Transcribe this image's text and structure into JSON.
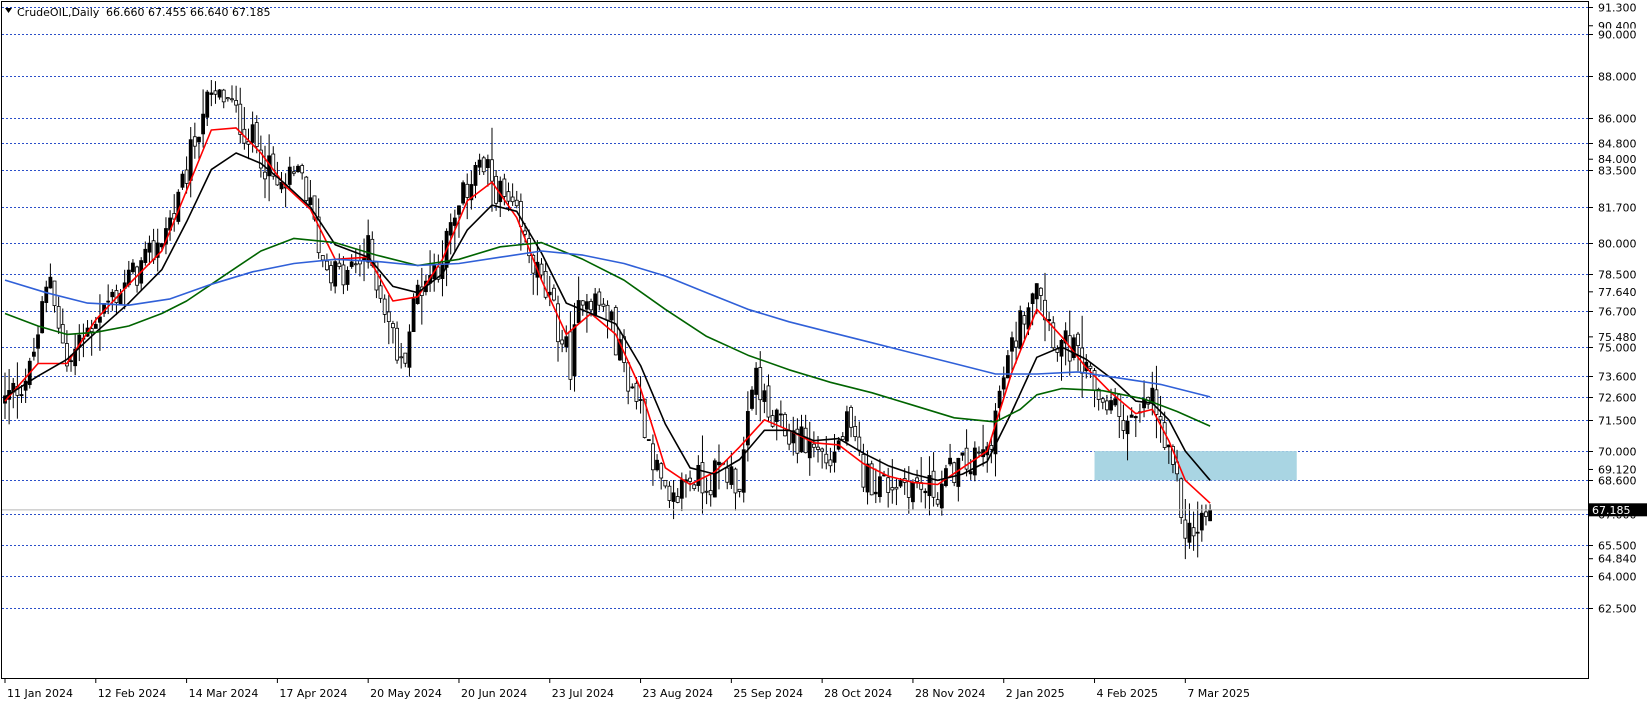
{
  "chart_header": {
    "symbol": "CrudeOIL,Daily",
    "ohlc": "66.660 67.455 66.640 67.185"
  },
  "colors": {
    "grid": "#2b4fc9",
    "candle": "#000000",
    "ma_fast": "#ff0000",
    "ma_medium": "#000000",
    "ma_slow": "#006400",
    "ma_long": "#3060d8",
    "zone_fill": "#a9d5e3",
    "current_line": "#b8b8b8"
  },
  "chart_data": {
    "type": "candlestick",
    "title": "CrudeOIL,Daily",
    "header_ohlc": {
      "open": 66.66,
      "high": 67.455,
      "low": 66.64,
      "close": 67.185
    },
    "current_price_label": "67.185",
    "ylim": [
      62.0,
      91.4
    ],
    "y_gridlines": [
      91.3,
      90.0,
      88.0,
      86.0,
      84.8,
      83.5,
      81.7,
      80.0,
      78.5,
      76.7,
      75.0,
      73.6,
      72.6,
      71.5,
      70.0,
      68.6,
      67.0,
      65.5,
      64.0,
      62.5
    ],
    "y_gridline_labels": [
      "91.300",
      "90.000",
      "88.000",
      "86.000",
      "84.800",
      "83.500",
      "81.700",
      "80.000",
      "78.500",
      "76.700",
      "75.000",
      "73.600",
      "72.600",
      "71.500",
      "70.000",
      "68.600",
      "67.000",
      "65.500",
      "64.000",
      "62.500"
    ],
    "y_scale_ticks": [
      90.4,
      84.0,
      77.64,
      75.48,
      69.12,
      64.84
    ],
    "y_scale_tick_labels": [
      "90.400",
      "84.000",
      "77.640",
      "75.480",
      "69.120",
      "64.840"
    ],
    "x_tick_labels": [
      "11 Jan 2024",
      "12 Feb 2024",
      "14 Mar 2024",
      "17 Apr 2024",
      "20 May 2024",
      "20 Jun 2024",
      "23 Jul 2024",
      "23 Aug 2024",
      "25 Sep 2024",
      "28 Oct 2024",
      "28 Nov 2024",
      "2 Jan 2025",
      "4 Feb 2025",
      "7 Mar 2025"
    ],
    "x_tick_bar_index": [
      0,
      22,
      44,
      66,
      88,
      110,
      132,
      154,
      176,
      198,
      220,
      242,
      264,
      286
    ],
    "close_path": [
      [
        0,
        72.4
      ],
      [
        6,
        73.8
      ],
      [
        11,
        78.5
      ],
      [
        15,
        74.0
      ],
      [
        22,
        76.5
      ],
      [
        28,
        77.8
      ],
      [
        35,
        79.2
      ],
      [
        42,
        81.8
      ],
      [
        48,
        86.5
      ],
      [
        53,
        87.0
      ],
      [
        58,
        85.5
      ],
      [
        62,
        84.3
      ],
      [
        66,
        82.5
      ],
      [
        72,
        83.2
      ],
      [
        77,
        79.2
      ],
      [
        82,
        78.2
      ],
      [
        88,
        79.6
      ],
      [
        92,
        77.0
      ],
      [
        96,
        74.0
      ],
      [
        100,
        77.8
      ],
      [
        105,
        79.0
      ],
      [
        110,
        81.5
      ],
      [
        114,
        83.8
      ],
      [
        118,
        83.0
      ],
      [
        124,
        81.0
      ],
      [
        128,
        79.0
      ],
      [
        133,
        76.5
      ],
      [
        137,
        74.2
      ],
      [
        140,
        77.8
      ],
      [
        146,
        76.6
      ],
      [
        151,
        73.5
      ],
      [
        154,
        72.2
      ],
      [
        158,
        69.0
      ],
      [
        161,
        67.0
      ],
      [
        165,
        68.8
      ],
      [
        170,
        68.5
      ],
      [
        174,
        69.2
      ],
      [
        178,
        68.5
      ],
      [
        182,
        73.8
      ],
      [
        185,
        71.5
      ],
      [
        190,
        70.8
      ],
      [
        196,
        70.2
      ],
      [
        200,
        69.5
      ],
      [
        204,
        71.2
      ],
      [
        208,
        68.9
      ],
      [
        213,
        68.4
      ],
      [
        218,
        68.6
      ],
      [
        222,
        68.2
      ],
      [
        226,
        68.1
      ],
      [
        230,
        69.2
      ],
      [
        234,
        69.3
      ],
      [
        238,
        70.0
      ],
      [
        242,
        73.5
      ],
      [
        246,
        76.2
      ],
      [
        250,
        78.6
      ],
      [
        252,
        76.8
      ],
      [
        255,
        75.2
      ],
      [
        259,
        74.8
      ],
      [
        262,
        73.5
      ],
      [
        266,
        72.5
      ],
      [
        270,
        71.8
      ],
      [
        274,
        71.3
      ],
      [
        278,
        72.6
      ],
      [
        282,
        69.5
      ],
      [
        284,
        68.2
      ],
      [
        286,
        66.2
      ],
      [
        288,
        66.0
      ],
      [
        290,
        66.7
      ],
      [
        292,
        67.2
      ]
    ],
    "series": [
      {
        "type": "line",
        "points": [
          [
            0,
            72.4
          ],
          [
            8,
            74.2
          ],
          [
            15,
            74.2
          ],
          [
            22,
            76.3
          ],
          [
            30,
            78.0
          ],
          [
            38,
            79.6
          ],
          [
            44,
            82.5
          ],
          [
            50,
            85.4
          ],
          [
            56,
            85.5
          ],
          [
            62,
            84.3
          ],
          [
            68,
            82.7
          ],
          [
            74,
            81.6
          ],
          [
            80,
            79.2
          ],
          [
            88,
            79.3
          ],
          [
            94,
            77.2
          ],
          [
            100,
            77.4
          ],
          [
            106,
            79.2
          ],
          [
            112,
            82.0
          ],
          [
            118,
            82.9
          ],
          [
            124,
            81.2
          ],
          [
            130,
            78.2
          ],
          [
            136,
            75.6
          ],
          [
            142,
            76.6
          ],
          [
            148,
            75.6
          ],
          [
            154,
            73.0
          ],
          [
            160,
            69.2
          ],
          [
            166,
            68.4
          ],
          [
            172,
            69.0
          ],
          [
            178,
            70.2
          ],
          [
            184,
            71.5
          ],
          [
            190,
            71.0
          ],
          [
            196,
            70.4
          ],
          [
            202,
            70.3
          ],
          [
            208,
            69.4
          ],
          [
            214,
            68.8
          ],
          [
            220,
            68.5
          ],
          [
            226,
            68.4
          ],
          [
            232,
            69.2
          ],
          [
            238,
            70.0
          ],
          [
            244,
            73.8
          ],
          [
            250,
            76.8
          ],
          [
            256,
            75.5
          ],
          [
            262,
            74.0
          ],
          [
            268,
            72.8
          ],
          [
            274,
            71.8
          ],
          [
            278,
            72.0
          ],
          [
            282,
            70.5
          ],
          [
            286,
            68.6
          ],
          [
            292,
            67.5
          ]
        ]
      },
      {
        "type": "line",
        "points": [
          [
            0,
            72.6
          ],
          [
            8,
            73.6
          ],
          [
            15,
            74.4
          ],
          [
            22,
            75.7
          ],
          [
            30,
            77.1
          ],
          [
            38,
            78.7
          ],
          [
            44,
            81.0
          ],
          [
            50,
            83.5
          ],
          [
            56,
            84.3
          ],
          [
            62,
            83.8
          ],
          [
            68,
            82.8
          ],
          [
            74,
            81.7
          ],
          [
            80,
            79.9
          ],
          [
            88,
            79.3
          ],
          [
            94,
            77.9
          ],
          [
            100,
            77.6
          ],
          [
            106,
            78.5
          ],
          [
            112,
            80.6
          ],
          [
            118,
            81.8
          ],
          [
            124,
            81.5
          ],
          [
            130,
            79.5
          ],
          [
            136,
            77.1
          ],
          [
            142,
            76.6
          ],
          [
            148,
            76.1
          ],
          [
            154,
            74.1
          ],
          [
            160,
            71.3
          ],
          [
            166,
            69.2
          ],
          [
            172,
            68.9
          ],
          [
            178,
            69.6
          ],
          [
            184,
            71.0
          ],
          [
            190,
            71.0
          ],
          [
            196,
            70.5
          ],
          [
            202,
            70.6
          ],
          [
            208,
            69.9
          ],
          [
            214,
            69.3
          ],
          [
            220,
            68.9
          ],
          [
            226,
            68.6
          ],
          [
            232,
            68.9
          ],
          [
            238,
            69.5
          ],
          [
            244,
            71.9
          ],
          [
            250,
            74.5
          ],
          [
            256,
            75.0
          ],
          [
            262,
            74.4
          ],
          [
            268,
            73.5
          ],
          [
            274,
            72.4
          ],
          [
            278,
            72.3
          ],
          [
            282,
            71.5
          ],
          [
            286,
            70.0
          ],
          [
            292,
            68.6
          ]
        ]
      },
      {
        "type": "line",
        "points": [
          [
            0,
            76.6
          ],
          [
            8,
            76.0
          ],
          [
            15,
            75.6
          ],
          [
            22,
            75.7
          ],
          [
            30,
            76.0
          ],
          [
            38,
            76.6
          ],
          [
            44,
            77.2
          ],
          [
            50,
            78.0
          ],
          [
            56,
            78.8
          ],
          [
            62,
            79.6
          ],
          [
            70,
            80.2
          ],
          [
            80,
            80.0
          ],
          [
            90,
            79.4
          ],
          [
            100,
            78.9
          ],
          [
            110,
            79.2
          ],
          [
            120,
            79.8
          ],
          [
            130,
            80.0
          ],
          [
            140,
            79.2
          ],
          [
            150,
            78.2
          ],
          [
            160,
            76.8
          ],
          [
            170,
            75.5
          ],
          [
            180,
            74.6
          ],
          [
            190,
            73.9
          ],
          [
            200,
            73.3
          ],
          [
            210,
            72.8
          ],
          [
            220,
            72.2
          ],
          [
            230,
            71.6
          ],
          [
            240,
            71.4
          ],
          [
            246,
            72.0
          ],
          [
            250,
            72.7
          ],
          [
            256,
            73.0
          ],
          [
            266,
            72.9
          ],
          [
            276,
            72.5
          ],
          [
            284,
            71.9
          ],
          [
            292,
            71.2
          ]
        ]
      },
      {
        "type": "line",
        "points": [
          [
            0,
            78.2
          ],
          [
            10,
            77.6
          ],
          [
            20,
            77.1
          ],
          [
            30,
            77.0
          ],
          [
            40,
            77.3
          ],
          [
            50,
            78.0
          ],
          [
            60,
            78.6
          ],
          [
            70,
            79.0
          ],
          [
            80,
            79.2
          ],
          [
            90,
            79.1
          ],
          [
            100,
            78.9
          ],
          [
            110,
            79.0
          ],
          [
            120,
            79.3
          ],
          [
            130,
            79.6
          ],
          [
            140,
            79.4
          ],
          [
            150,
            79.0
          ],
          [
            160,
            78.4
          ],
          [
            170,
            77.6
          ],
          [
            180,
            76.8
          ],
          [
            190,
            76.2
          ],
          [
            200,
            75.7
          ],
          [
            210,
            75.2
          ],
          [
            220,
            74.7
          ],
          [
            230,
            74.2
          ],
          [
            240,
            73.7
          ],
          [
            250,
            73.7
          ],
          [
            260,
            73.8
          ],
          [
            270,
            73.5
          ],
          [
            280,
            73.2
          ],
          [
            292,
            72.6
          ]
        ]
      }
    ],
    "zone": {
      "x_start": 264,
      "x_end": 313,
      "y_low": 68.6,
      "y_high": 70.0
    },
    "grid": true
  }
}
